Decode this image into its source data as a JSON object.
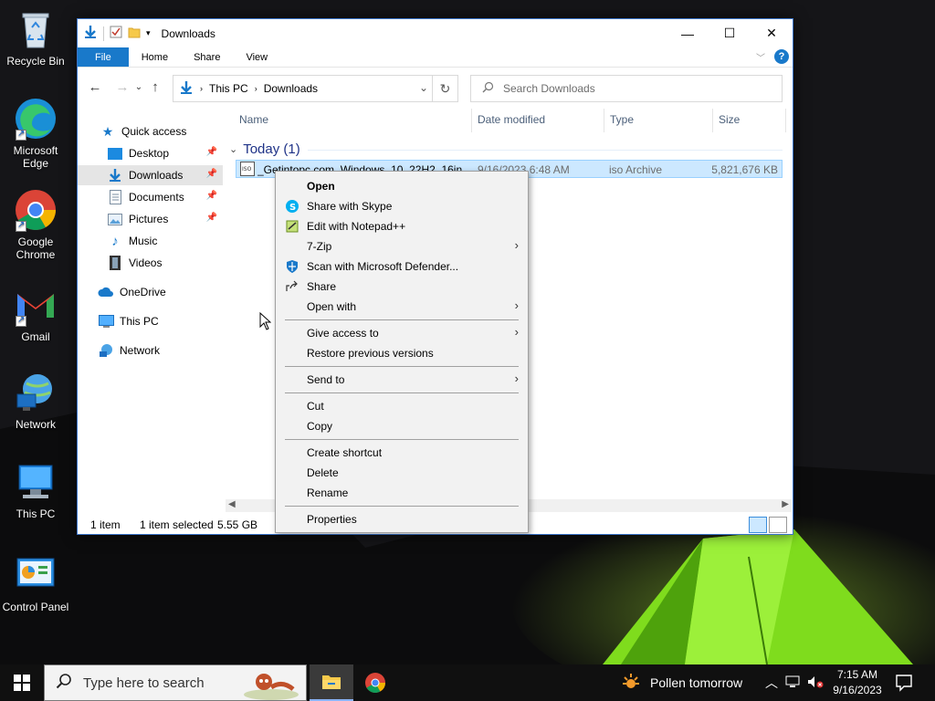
{
  "desktop": {
    "icons": [
      {
        "label": "Recycle Bin",
        "icon": "recycle-bin-icon"
      },
      {
        "label": "Microsoft Edge",
        "icon": "edge-icon"
      },
      {
        "label": "Google Chrome",
        "icon": "chrome-icon"
      },
      {
        "label": "Gmail",
        "icon": "gmail-icon"
      },
      {
        "label": "Network",
        "icon": "network-icon"
      },
      {
        "label": "This PC",
        "icon": "this-pc-icon"
      },
      {
        "label": "Control Panel",
        "icon": "control-panel-icon"
      }
    ]
  },
  "explorer": {
    "title": "Downloads",
    "ribbon_tabs": [
      "File",
      "Home",
      "Share",
      "View"
    ],
    "address": {
      "root": "This PC",
      "current": "Downloads"
    },
    "search_placeholder": "Search Downloads",
    "nav": {
      "quick_access": "Quick access",
      "items": [
        "Desktop",
        "Downloads",
        "Documents",
        "Pictures",
        "Music",
        "Videos"
      ],
      "onedrive": "OneDrive",
      "this_pc": "This PC",
      "network": "Network"
    },
    "columns": {
      "name": "Name",
      "date": "Date modified",
      "type": "Type",
      "size": "Size"
    },
    "group": "Today (1)",
    "file": {
      "name": "_Getintopc.com_Windows_10_22H2_16in...",
      "date": "9/16/2023 6:48 AM",
      "type": "iso Archive",
      "size": "5,821,676 KB"
    },
    "status": {
      "count": "1 item",
      "selected": "1 item selected",
      "size": "5.55 GB"
    }
  },
  "context_menu": {
    "open": "Open",
    "skype": "Share with Skype",
    "notepad": "Edit with Notepad++",
    "zip": "7-Zip",
    "defender": "Scan with Microsoft Defender...",
    "share": "Share",
    "open_with": "Open with",
    "give_access": "Give access to",
    "restore": "Restore previous versions",
    "send_to": "Send to",
    "cut": "Cut",
    "copy": "Copy",
    "shortcut": "Create shortcut",
    "delete": "Delete",
    "rename": "Rename",
    "properties": "Properties"
  },
  "taskbar": {
    "search_placeholder": "Type here to search",
    "weather": "Pollen tomorrow",
    "time": "7:15 AM",
    "date": "9/16/2023"
  },
  "colors": {
    "accent": "#1979ca",
    "selection": "#cce8ff",
    "taskbar": "#101010"
  }
}
